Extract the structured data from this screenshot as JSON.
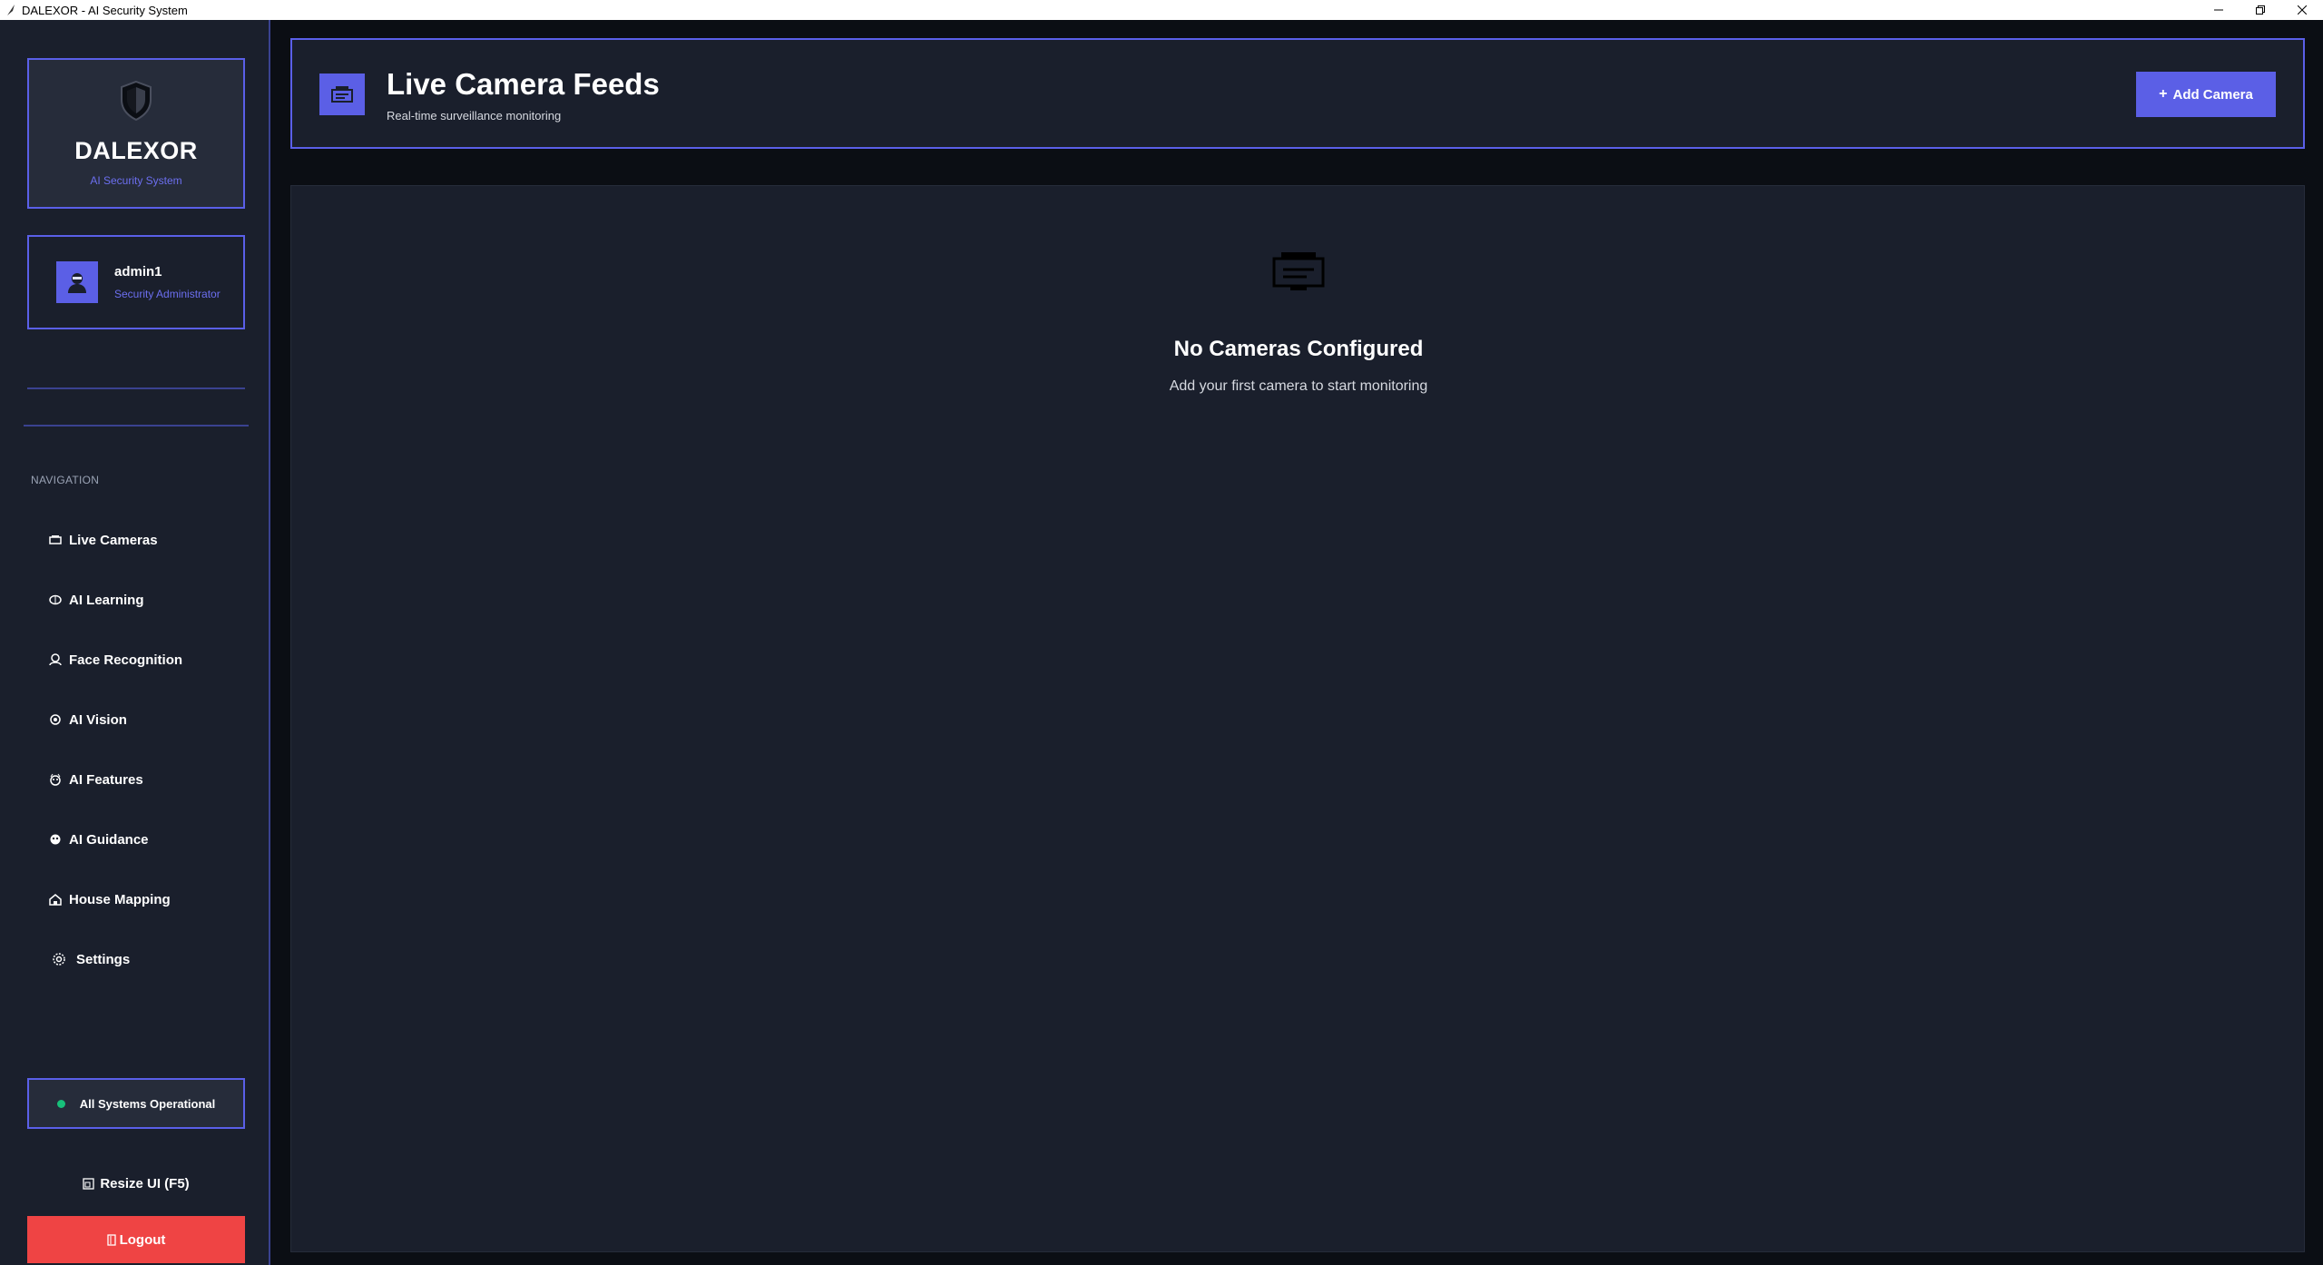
{
  "window": {
    "title": "DALEXOR - AI Security System",
    "controls": [
      "minimize-icon",
      "restore-icon",
      "close-icon"
    ]
  },
  "brand": {
    "name": "DALEXOR",
    "subtitle": "AI Security System",
    "icon": "shield-icon"
  },
  "user": {
    "name": "admin1",
    "role": "Security Administrator",
    "icon": "user-avatar-icon"
  },
  "nav": {
    "heading": "NAVIGATION",
    "items": [
      {
        "label": "Live Cameras",
        "icon": "camera-icon"
      },
      {
        "label": "AI Learning",
        "icon": "brain-icon"
      },
      {
        "label": "Face Recognition",
        "icon": "face-icon"
      },
      {
        "label": "AI Vision",
        "icon": "vision-icon"
      },
      {
        "label": "AI Features",
        "icon": "features-icon"
      },
      {
        "label": "AI Guidance",
        "icon": "guidance-icon"
      },
      {
        "label": "House Mapping",
        "icon": "house-icon"
      },
      {
        "label": "Settings",
        "icon": "gear-icon"
      }
    ]
  },
  "status": {
    "text": "All Systems Operational",
    "color": "#17c07a"
  },
  "resize": {
    "label": "Resize UI (F5)"
  },
  "logout": {
    "label": "Logout",
    "color": "#ef4444"
  },
  "header": {
    "title": "Live Camera Feeds",
    "subtitle": "Real-time surveillance monitoring",
    "add_label": "Add Camera"
  },
  "empty": {
    "title": "No Cameras Configured",
    "subtitle": "Add your first camera to start monitoring"
  },
  "colors": {
    "accent": "#5b5fe6",
    "panel": "#1a1f2c",
    "background": "#0b0e14"
  }
}
